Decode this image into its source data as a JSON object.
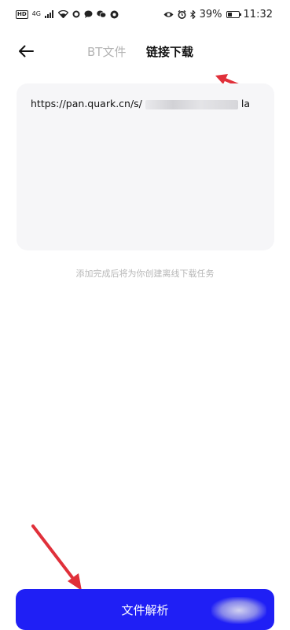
{
  "status_bar": {
    "hd": "HD",
    "network": "4G",
    "battery_percent_label": "39%",
    "battery_level": 0.39,
    "time": "11:32",
    "icons": [
      "hd-badge-icon",
      "signal-icon",
      "wifi-icon",
      "circle-icon",
      "chat-icon",
      "wechat-icon",
      "browser-icon",
      "eye-icon",
      "alarm-icon",
      "bluetooth-icon",
      "battery-icon"
    ]
  },
  "header": {
    "back_icon": "arrow-left-icon",
    "tabs": [
      {
        "label": "BT文件",
        "active": false
      },
      {
        "label": "链接下载",
        "active": true
      }
    ]
  },
  "link_input": {
    "value_start": "https://pan.quark.cn/s/",
    "value_end": "la"
  },
  "hint_text": "添加完成后将为你创建离线下载任务",
  "parse_button": {
    "label": "文件解析"
  },
  "colors": {
    "accent": "#1f1ff5",
    "annotation_arrow": "#e0303a",
    "input_bg": "#f6f6f8"
  }
}
